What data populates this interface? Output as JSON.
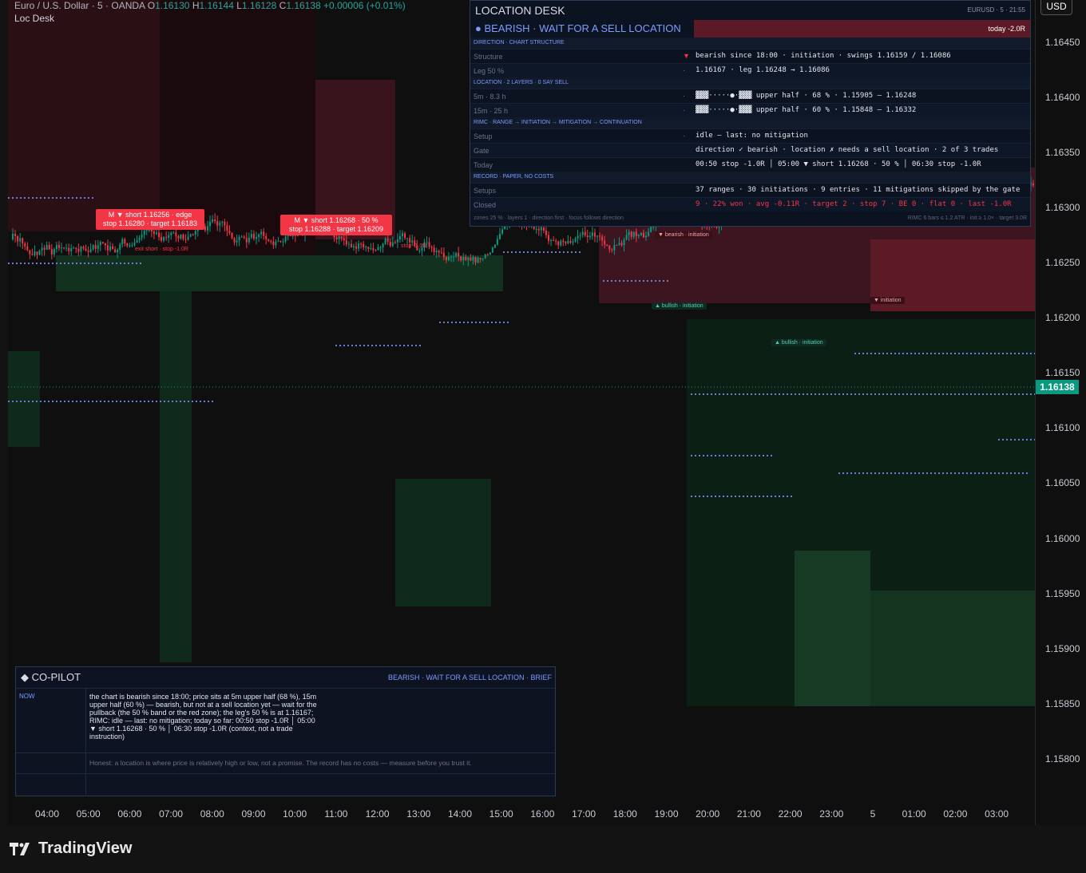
{
  "legend": {
    "symbol": "Euro / U.S. Dollar · 5 · OANDA",
    "o_label": "O",
    "o": "1.16130",
    "h_label": "H",
    "h": "1.16144",
    "l_label": "L",
    "l": "1.16128",
    "c_label": "C",
    "c": "1.16138",
    "change": "+0.00006 (+0.01%)",
    "indicator": "Loc Desk"
  },
  "currency_button": "USD",
  "current_price": "1.16138",
  "price_axis": [
    "1.16450",
    "1.16400",
    "1.16350",
    "1.16300",
    "1.16250",
    "1.16200",
    "1.16150",
    "1.16100",
    "1.16050",
    "1.16000",
    "1.15950",
    "1.15900",
    "1.15850",
    "1.15800"
  ],
  "time_axis": [
    "04:00",
    "05:00",
    "06:00",
    "07:00",
    "08:00",
    "09:00",
    "10:00",
    "11:00",
    "12:00",
    "13:00",
    "14:00",
    "15:00",
    "16:00",
    "17:00",
    "18:00",
    "19:00",
    "20:00",
    "21:00",
    "22:00",
    "23:00",
    "5",
    "01:00",
    "02:00",
    "03:00"
  ],
  "chart_tags": {
    "tag1_l1": "M ▼ short 1.16256 · edge",
    "tag1_l2": "stop 1.16280 · target 1.16183",
    "tag2_l1": "M ▼ short 1.16268 · 50 %",
    "tag2_l2": "stop 1.16288 · target 1.16209",
    "exit1": "exit short · stop -1.0R",
    "exit2": "stop -1.0R",
    "bearish_init": "▼ bearish · initiation",
    "bullish_init1": "▲ bullish · initiation",
    "bullish_init2": "▲ bullish · initiation",
    "init3": "▼ initiation"
  },
  "desk": {
    "title": "LOCATION DESK",
    "meta": "EURUSD · 5 · 21:55",
    "status": "● BEARISH · WAIT FOR A SELL LOCATION",
    "today": "today -2.0R",
    "sections": {
      "direction": "DIRECTION · CHART STRUCTURE",
      "location": "LOCATION · 2 LAYERS · 0 SAY SELL",
      "rimc": "RIMC · RANGE → INITIATION → MITIGATION → CONTINUATION",
      "record": "RECORD · PAPER, NO COSTS"
    },
    "rows": {
      "structure_k": "Structure",
      "structure_v": "bearish since 18:00 · initiation · swings 1.16159 / 1.16086",
      "leg_k": "Leg 50 %",
      "leg_v": "1.16167 · leg 1.16248 → 1.16086",
      "m5_k": "5m · 8.3 h",
      "m5_v": "▓▓▓·····●·▓▓▓  upper half · 68 % · 1.15905 – 1.16248",
      "m15_k": "15m · 25 h",
      "m15_v": "▓▓▓·····●·▓▓▓  upper half · 60 % · 1.15848 – 1.16332",
      "setup_k": "Setup",
      "setup_v": "idle — last: no mitigation",
      "gate_k": "Gate",
      "gate_v": "direction ✓ bearish · location ✗ needs a sell location · 2 of 3 trades",
      "today_k": "Today",
      "today_v": "00:50 stop -1.0R │ 05:00 ▼ short 1.16268 · 50 % │ 06:30 stop -1.0R",
      "setups_k": "Setups",
      "setups_v": "37 ranges · 30 initiations · 9 entries · 11 mitigations skipped by the gate",
      "closed_k": "Closed",
      "closed_v": "9 · 22% won · avg -0.11R · target 2 · stop 7 · BE 0 · flat 0 · last -1.0R"
    },
    "dash": "·",
    "foot_left": "zones 25 % · layers 1 · direction first · focus follows direction",
    "foot_right": "RIMC 6 bars ≤ 1.2 ATR · init ≥ 1.0× · target 3.0R"
  },
  "copilot": {
    "title": "◆ CO-PILOT",
    "headline": "BEARISH · WAIT FOR A SELL LOCATION · BRIEF",
    "now_label": "NOW",
    "text": "the chart is bearish since 18:00; price sits at 5m upper half (68 %), 15m upper half (60 %) — bearish, but not at a sell location yet — wait for the pullback (the 50 % band or the red zone); the leg's 50 % is at 1.16167; RIMC: idle — last: no mitigation; today so far: 00:50 stop -1.0R │ 05:00 ▼ short 1.16268 · 50 % │ 06:30 stop -1.0R (context, not a trade instruction)",
    "honest": "Honest: a location is where price is relatively high or low, not a promise. The record has no costs — measure before you trust it."
  },
  "brand": "TradingView",
  "colors": {
    "bull": "#089981",
    "bear": "#f23645",
    "accent": "#7c9cff",
    "zone_red": "#5b1a26",
    "zone_green": "#173a25"
  }
}
